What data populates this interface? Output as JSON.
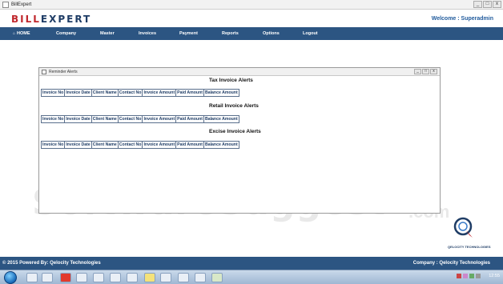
{
  "window": {
    "title": "BillExpert",
    "minimize": "_",
    "maximize": "□",
    "close": "x"
  },
  "header": {
    "logo_part1": "BILL",
    "logo_part2": "EXPERT",
    "welcome": "Welcome : Superadmin"
  },
  "nav": {
    "items": [
      "HOME",
      "Company",
      "Master",
      "Invoices",
      "Payment",
      "Reports",
      "Options",
      "Logout"
    ]
  },
  "reminder": {
    "title": "Reminder Alerts",
    "sections": [
      {
        "title": "Tax Invoice Alerts"
      },
      {
        "title": "Retail Invoice Alerts"
      },
      {
        "title": "Excise Invoice Alerts"
      }
    ],
    "columns": [
      "Invoice No",
      "Invoice Date",
      "Client Name",
      "Contact No",
      "Invoice Amount",
      "Paid Amount",
      "Balance Amount"
    ]
  },
  "watermark": {
    "text": "SoftwareSuggest",
    "suffix": ".com"
  },
  "brand": {
    "company_logo_text": "QELOCITY TECHNOLOGIES"
  },
  "footer": {
    "left": "© 2015 Powered By: Qelocity Technologies",
    "right": "Company : Qelocity Technologies"
  },
  "taskbar": {
    "time": "12:55"
  },
  "icons": {
    "start": "windows-start-icon",
    "home": "home-icon"
  },
  "colors": {
    "nav_bg": "#2c5582",
    "logo_red": "#c0282d",
    "logo_blue": "#1f3d66",
    "link_blue": "#1f5a9c"
  }
}
